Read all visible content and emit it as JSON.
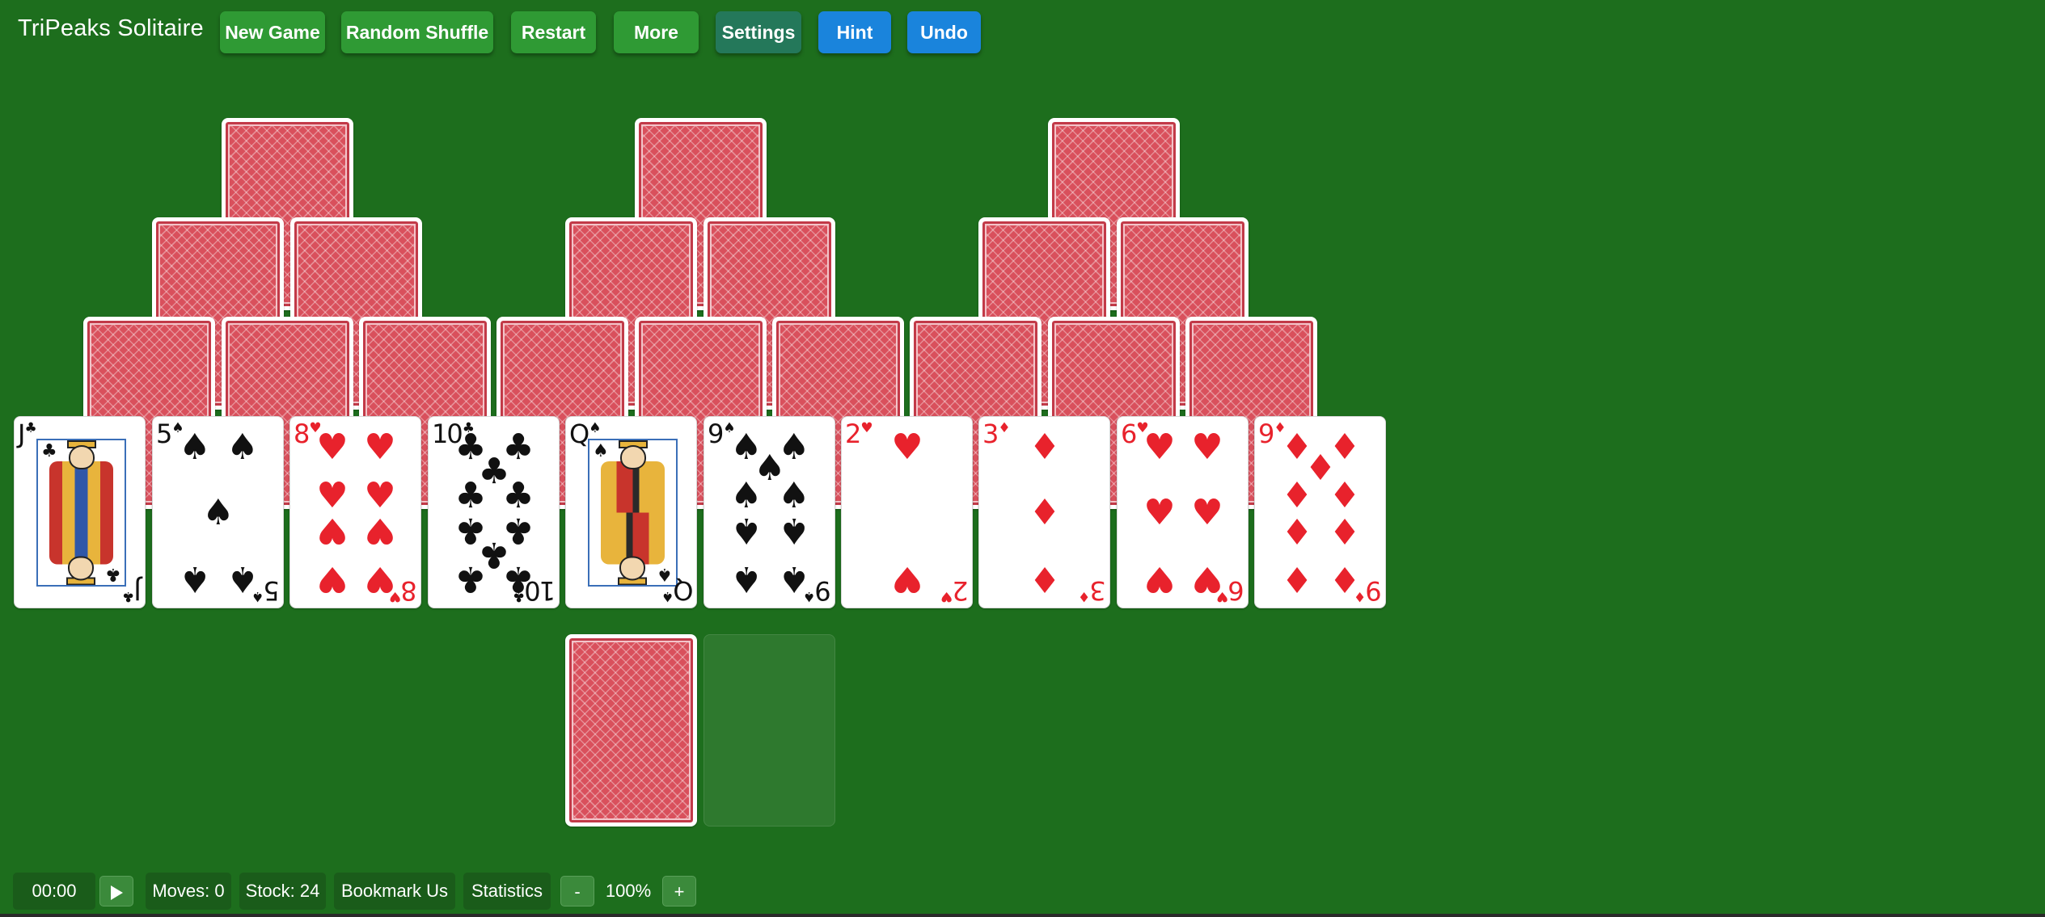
{
  "header": {
    "title": "TriPeaks Solitaire",
    "buttons": {
      "new_game": "New Game",
      "random_shuffle": "Random Shuffle",
      "restart": "Restart",
      "more": "More",
      "settings": "Settings",
      "hint": "Hint",
      "undo": "Undo"
    }
  },
  "tableau": {
    "face_down_count": 18,
    "face_up": [
      {
        "rank": "J",
        "suit": "♣",
        "color": "black"
      },
      {
        "rank": "5",
        "suit": "♠",
        "color": "black"
      },
      {
        "rank": "8",
        "suit": "♥",
        "color": "red"
      },
      {
        "rank": "10",
        "suit": "♣",
        "color": "black"
      },
      {
        "rank": "Q",
        "suit": "♠",
        "color": "black"
      },
      {
        "rank": "9",
        "suit": "♠",
        "color": "black"
      },
      {
        "rank": "2",
        "suit": "♥",
        "color": "red"
      },
      {
        "rank": "3",
        "suit": "♦",
        "color": "red"
      },
      {
        "rank": "6",
        "suit": "♥",
        "color": "red"
      },
      {
        "rank": "9",
        "suit": "♦",
        "color": "red"
      }
    ]
  },
  "stock": {
    "face_down": true,
    "waste_empty": true
  },
  "footer": {
    "timer": "00:00",
    "play_icon": "play-icon",
    "moves": "Moves: 0",
    "stock": "Stock: 24",
    "bookmark": "Bookmark Us",
    "statistics": "Statistics",
    "zoom_out": "-",
    "zoom": "100%",
    "zoom_in": "+"
  },
  "colors": {
    "table_green": "#1d6e1d",
    "button_green": "#2f9a34",
    "button_teal": "#24785a",
    "button_blue": "#1a84dc",
    "card_back_red": "#d9505c",
    "suit_red": "#e8222c"
  }
}
